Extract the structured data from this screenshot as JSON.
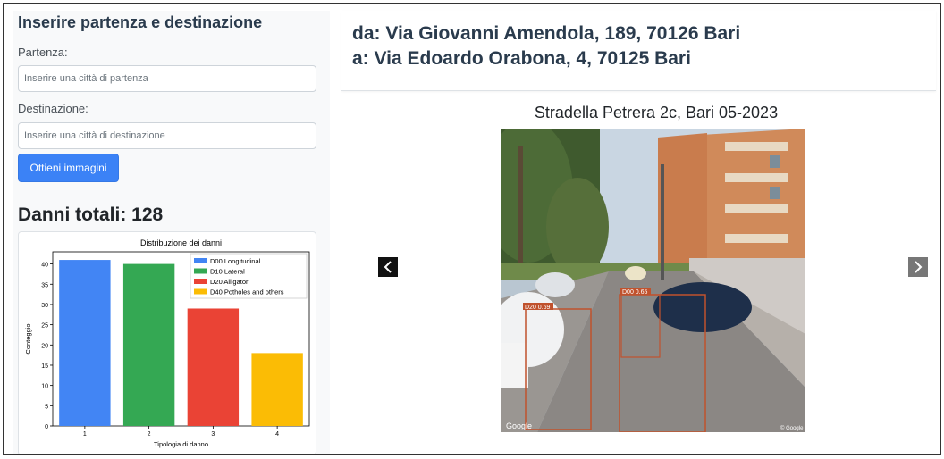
{
  "sidebar": {
    "title": "Inserire partenza e destinazione",
    "departure_label": "Partenza:",
    "departure_placeholder": "Inserire una città di partenza",
    "destination_label": "Destinazione:",
    "destination_placeholder": "Inserire una città di destinazione",
    "submit_label": "Ottieni immagini",
    "total_label": "Danni totali: 128"
  },
  "route": {
    "from": "da: Via Giovanni Amendola, 189, 70126 Bari",
    "to": "a: Via Edoardo Orabona, 4, 70125 Bari"
  },
  "viewer": {
    "caption": "Stradella Petrera 2c, Bari 05-2023",
    "prev_icon": "chevron-left-icon",
    "next_icon": "chevron-right-icon",
    "watermark_left": "Google",
    "watermark_right": "© Google",
    "detections": [
      {
        "label": "D20 0.69"
      },
      {
        "label": "D00 0.65"
      }
    ]
  },
  "chart_data": {
    "type": "bar",
    "title": "Distribuzione dei danni",
    "xlabel": "Tipologia di danno",
    "ylabel": "Conteggio",
    "categories": [
      "1",
      "2",
      "3",
      "4"
    ],
    "values": [
      41,
      40,
      29,
      18
    ],
    "colors": [
      "#4285f4",
      "#34a853",
      "#ea4335",
      "#fbbc05"
    ],
    "legend": [
      "D00 Longitudinal",
      "D10 Lateral",
      "D20 Alligator",
      "D40 Potholes and others"
    ],
    "legend_position": "top-right",
    "yticks": [
      0,
      5,
      10,
      15,
      20,
      25,
      30,
      35,
      40
    ],
    "ylim": [
      0,
      43
    ]
  }
}
